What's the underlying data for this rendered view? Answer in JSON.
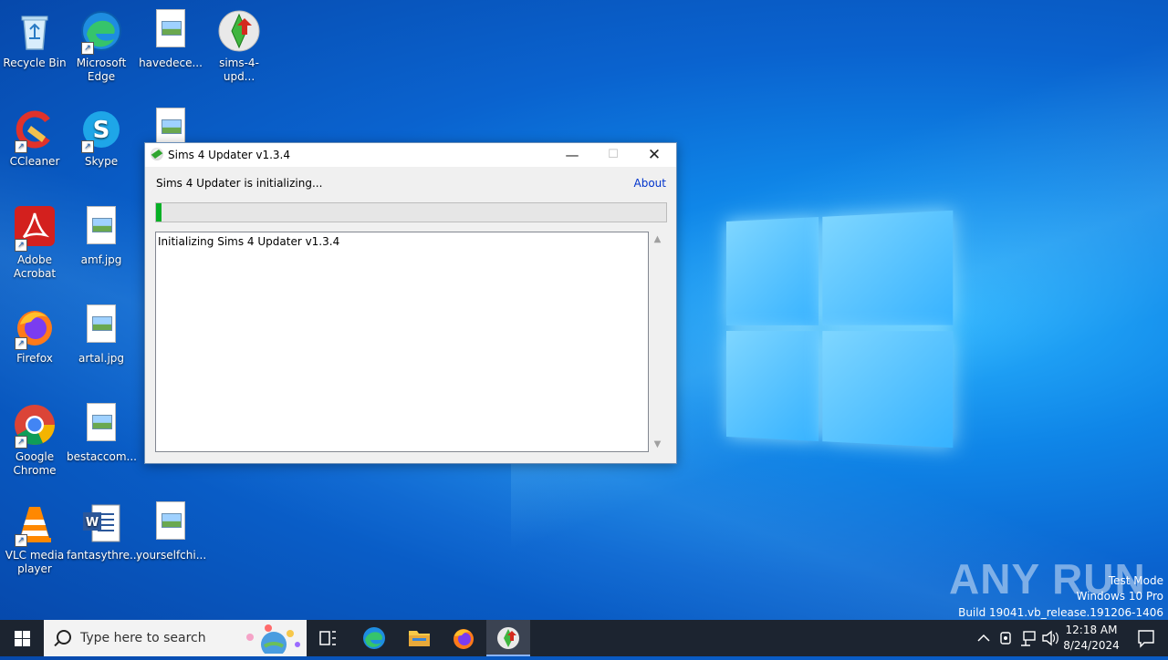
{
  "desktop": {
    "icons": [
      {
        "label": "Recycle Bin"
      },
      {
        "label": "Microsoft Edge"
      },
      {
        "label": "havedece..."
      },
      {
        "label": "sims-4-upd..."
      },
      {
        "label": "CCleaner"
      },
      {
        "label": "Skype"
      },
      {
        "label": "Adobe Acrobat"
      },
      {
        "label": "amf.jpg"
      },
      {
        "label": "Firefox"
      },
      {
        "label": "artal.jpg"
      },
      {
        "label": "Google Chrome"
      },
      {
        "label": "bestaccom..."
      },
      {
        "label": "VLC media player"
      },
      {
        "label": "fantasythre..."
      },
      {
        "label": "yourselfchi..."
      }
    ]
  },
  "dialog": {
    "title": "Sims 4 Updater v1.3.4",
    "status_text": "Sims 4 Updater is initializing...",
    "about_link": "About",
    "progress_fraction": 0.01,
    "log_text": "Initializing Sims 4 Updater v1.3.4",
    "buttons": {
      "minimize": "—",
      "maximize": "☐",
      "close": "✕"
    }
  },
  "watermark": {
    "brand": "ANY RUN",
    "line1": "Test Mode",
    "line2": "Windows 10 Pro",
    "line3": "Build 19041.vb_release.191206-1406"
  },
  "taskbar": {
    "search_placeholder": "Type here to search",
    "clock_time": "12:18 AM",
    "clock_date": "8/24/2024"
  },
  "colors": {
    "progress_fill": "#06b025",
    "taskbar_bg": "#1c2430",
    "link": "#0033cc"
  }
}
